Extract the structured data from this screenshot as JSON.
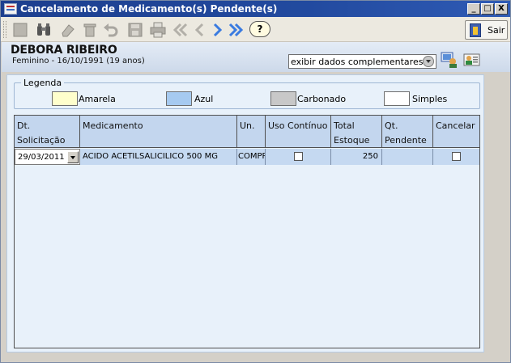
{
  "window": {
    "title": "Cancelamento de Medicamento(s) Pendente(s)",
    "min_label": "_",
    "max_label": "□",
    "close_label": "X"
  },
  "toolbar": {
    "buttons": [
      "new-icon",
      "binoculars-icon",
      "eraser-icon",
      "trash-icon",
      "undo-icon",
      "save-icon",
      "print-icon",
      "first-icon",
      "previous-icon",
      "next-icon",
      "last-icon"
    ],
    "help_label": "?",
    "exit_label": "Sair"
  },
  "patient": {
    "name": "DEBORA RIBEIRO",
    "info": "Feminino - 16/10/1991 (19 anos)",
    "complement_select": "exibir dados complementares..."
  },
  "legend": {
    "title": "Legenda",
    "items": [
      {
        "label": "Amarela",
        "color": "#ffffcc"
      },
      {
        "label": "Azul",
        "color": "#a6caf0"
      },
      {
        "label": "Carbonado",
        "color": "#c8c8c8"
      },
      {
        "label": "Simples",
        "color": "#ffffff"
      }
    ]
  },
  "grid": {
    "headers": {
      "date_line1": "Dt.",
      "date_line2": "Solicitação",
      "medication": "Medicamento",
      "unit": "Un.",
      "continuous": "Uso Contínuo",
      "stock_line1": "Total",
      "stock_line2": "Estoque",
      "pending_line1": "Qt.",
      "pending_line2": "Pendente",
      "cancel": "Cancelar"
    },
    "rows": [
      {
        "date": "29/03/2011",
        "medication": "ACIDO ACETILSALICILICO 500 MG",
        "unit": "COMPRIMIDO",
        "continuous": false,
        "stock": "250",
        "pending": "",
        "cancel": false
      }
    ]
  },
  "colors": {
    "titlebar": "#224a9f",
    "header_band": "#cdd9ea",
    "grid_header": "#c3d6ee",
    "row_highlight": "#c5d9f1"
  }
}
